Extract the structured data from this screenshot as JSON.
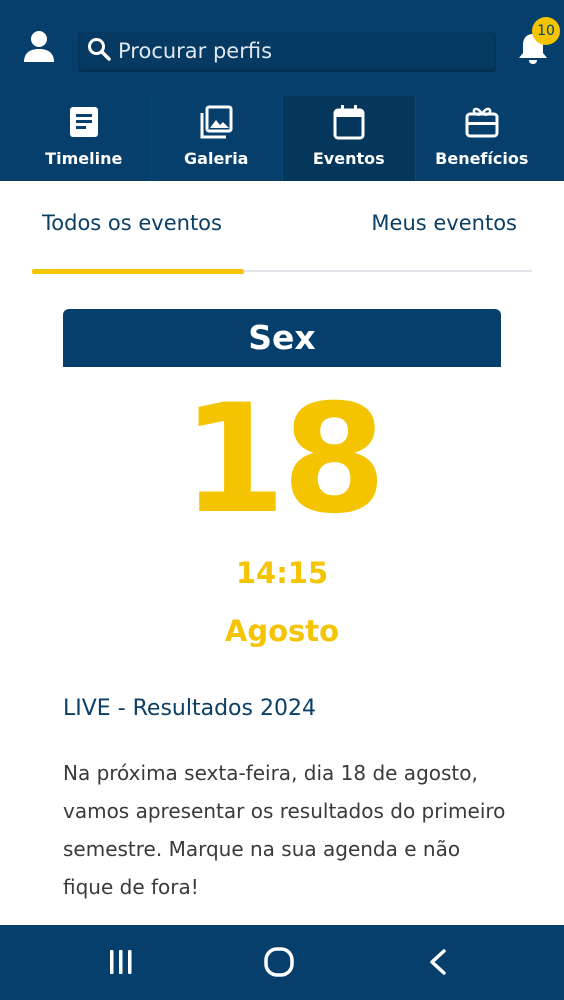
{
  "header": {
    "search": {
      "placeholder": "Procurar perfis"
    },
    "notifications": {
      "count": "10"
    },
    "nav": [
      {
        "label": "Timeline",
        "icon": "article-icon",
        "active": false
      },
      {
        "label": "Galeria",
        "icon": "gallery-icon",
        "active": false
      },
      {
        "label": "Eventos",
        "icon": "calendar-icon",
        "active": true
      },
      {
        "label": "Benefícios",
        "icon": "gift-card-icon",
        "active": false
      }
    ]
  },
  "tabs": {
    "all": "Todos os eventos",
    "mine": "Meus eventos",
    "active": "all"
  },
  "event": {
    "weekday": "Sex",
    "day": "18",
    "time": "14:15",
    "month": "Agosto",
    "title": "LIVE - Resultados 2024",
    "description": "Na próxima sexta-feira, dia 18 de agosto, vamos apresentar os resultados do primeiro semestre. Marque na sua agenda e não fique de fora!"
  },
  "system_nav": {
    "buttons": [
      "recent-apps-icon",
      "home-icon",
      "back-icon"
    ]
  },
  "colors": {
    "primary": "#063f6b",
    "accent": "#f5c400",
    "text_dark": "#0c3f66"
  }
}
